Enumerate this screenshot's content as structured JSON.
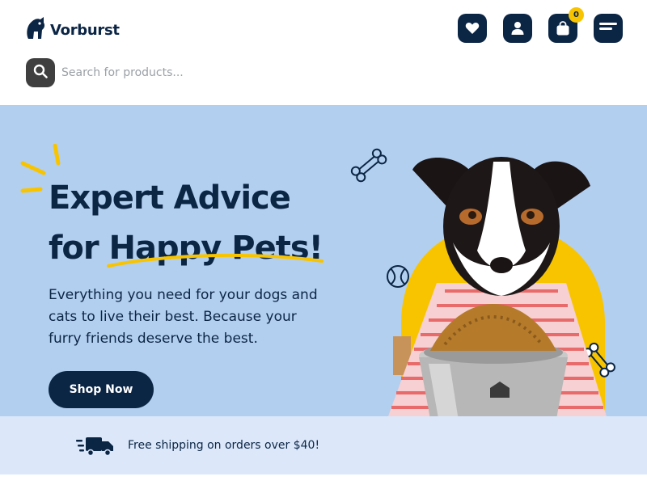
{
  "brand": {
    "name": "Vorburst"
  },
  "header": {
    "icons": [
      "heart-icon",
      "user-icon",
      "shopping-bag-icon",
      "menu-icon"
    ],
    "cart_count": "0"
  },
  "search": {
    "placeholder": "Search for products..."
  },
  "hero": {
    "title_line1": "Expert Advice",
    "title_line2": "for Happy Pets!",
    "subtitle": "Everything you need for your dogs and cats to live their best. Because your furry friends deserve the best.",
    "cta_label": "Shop Now"
  },
  "shipping": {
    "text": "Free shipping on orders over $40!"
  },
  "colors": {
    "navy": "#0b2545",
    "hero_bg": "#b3cff0",
    "accent_yellow": "#f8c400",
    "shipping_bg": "#dce8fa"
  }
}
